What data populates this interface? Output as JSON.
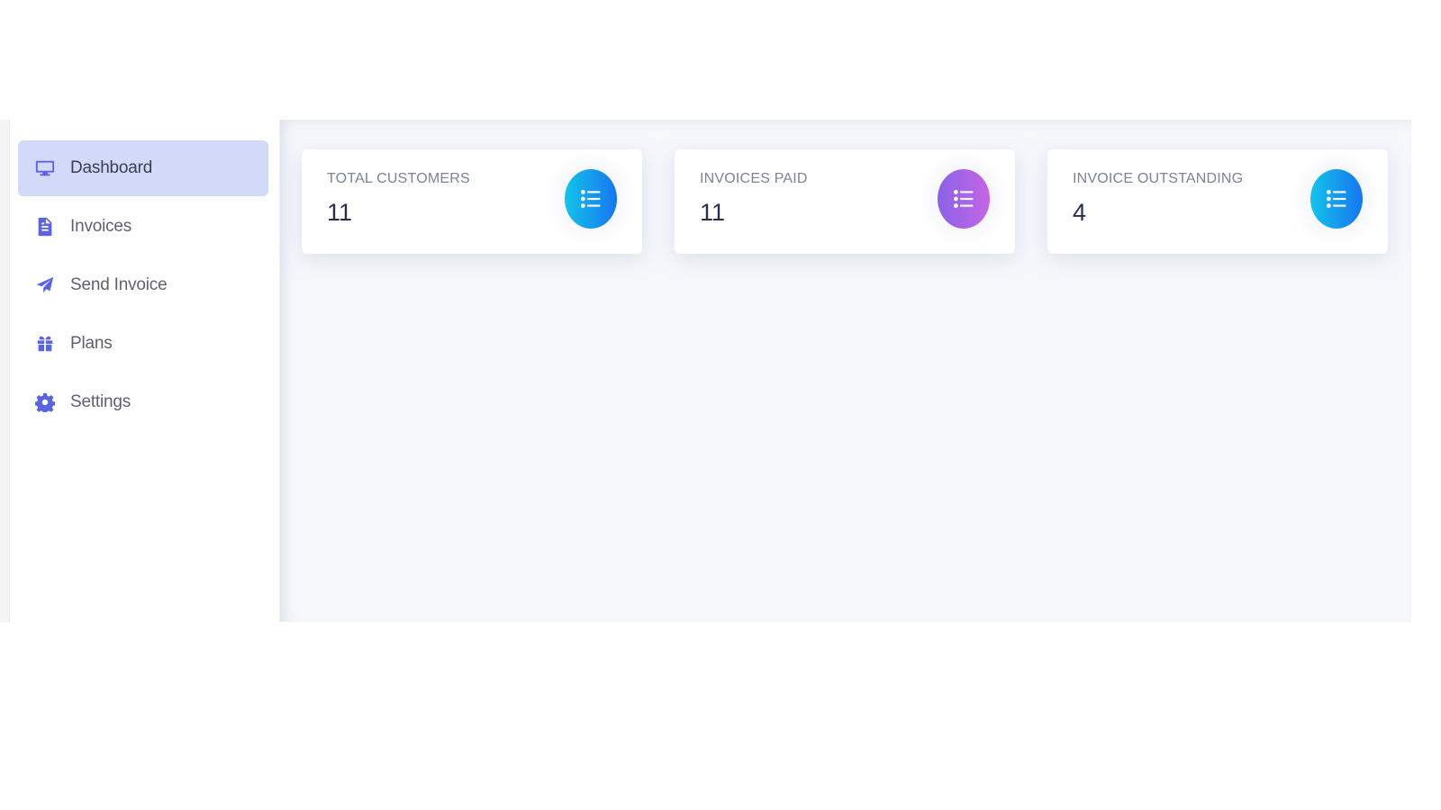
{
  "sidebar": {
    "items": [
      {
        "label": "Dashboard",
        "icon": "monitor-icon",
        "active": true
      },
      {
        "label": "Invoices",
        "icon": "file-icon",
        "active": false
      },
      {
        "label": "Send Invoice",
        "icon": "paper-plane-icon",
        "active": false
      },
      {
        "label": "Plans",
        "icon": "gift-icon",
        "active": false
      },
      {
        "label": "Settings",
        "icon": "gear-icon",
        "active": false
      }
    ]
  },
  "stats": [
    {
      "title": "TOTAL CUSTOMERS",
      "value": "11",
      "icon": "list-icon",
      "color": "#1a9bee"
    },
    {
      "title": "INVOICES PAID",
      "value": "11",
      "icon": "list-icon",
      "color": "#a764e6"
    },
    {
      "title": "INVOICE OUTSTANDING",
      "value": "4",
      "icon": "list-icon",
      "color": "#1a9bee"
    }
  ],
  "colors": {
    "accent": "#5b63e0",
    "active_bg": "#d3d9f8",
    "main_bg": "#f7f8fc"
  }
}
